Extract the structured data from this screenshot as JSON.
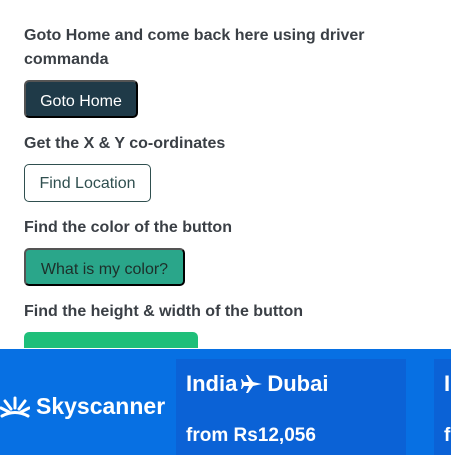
{
  "sections": {
    "goto_home": {
      "label": "Goto Home and come back here using driver commanda",
      "button": "Goto Home"
    },
    "location": {
      "label": "Get the X & Y co-ordinates",
      "button": "Find Location"
    },
    "color": {
      "label": "Find the color of the button",
      "button": "What is my color?"
    },
    "size": {
      "label": "Find the height & width of the button"
    }
  },
  "ad": {
    "brand": "Skyscanner",
    "route_from": "India",
    "route_to": "Dubai",
    "price": "from Rs12,056",
    "next_route": "I",
    "next_price": "f",
    "colors": {
      "background": "#0770e3",
      "panel": "#0b62d6"
    }
  }
}
